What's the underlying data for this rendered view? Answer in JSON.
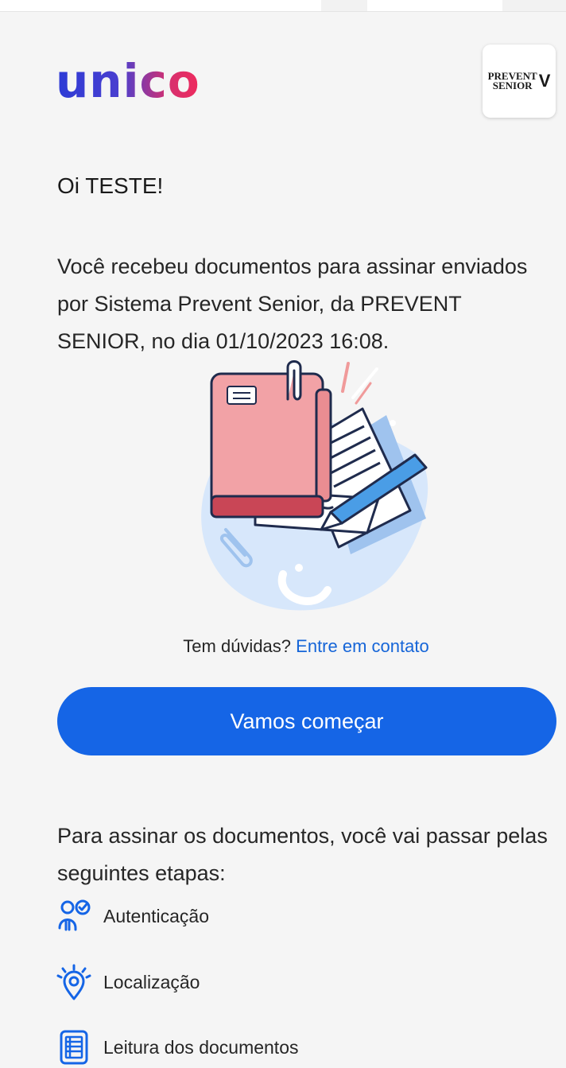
{
  "brand": {
    "logo_text": "unico",
    "partner_logo_line1": "PREVENT",
    "partner_logo_line2": "SENIOR"
  },
  "greeting": "Oi TESTE!",
  "intro": "Você recebeu documentos para assinar enviados por Sistema Prevent Senior, da PREVENT SENIOR, no dia 01/10/2023 16:08.",
  "help": {
    "question": "Tem dúvidas?",
    "link": "Entre em contato"
  },
  "cta": {
    "label": "Vamos começar"
  },
  "steps_intro": "Para assinar os documentos, você vai passar pelas seguintes etapas:",
  "steps": [
    {
      "icon": "user-check-icon",
      "label": "Autenticação"
    },
    {
      "icon": "location-pin-icon",
      "label": "Localização"
    },
    {
      "icon": "document-icon",
      "label": "Leitura dos documentos"
    }
  ],
  "colors": {
    "primary": "#1565e6",
    "link": "#1565d8",
    "background": "#f5f5f5"
  }
}
